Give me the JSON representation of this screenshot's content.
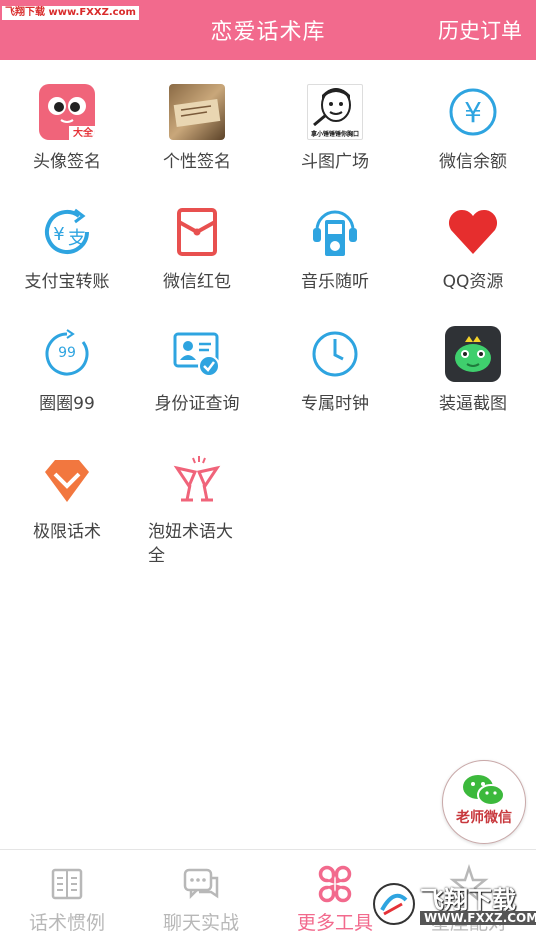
{
  "header": {
    "title": "恋爱话术库",
    "right_button": "历史订单",
    "watermark": "飞翔下载 www.FXXZ.com"
  },
  "tools": [
    {
      "label": "头像签名",
      "icon": "avatar-sticker-icon",
      "badge": "大全"
    },
    {
      "label": "个性签名",
      "icon": "signature-photo-icon"
    },
    {
      "label": "斗图广场",
      "icon": "meme-face-icon",
      "caption": "拿小锤锤锤你胸口"
    },
    {
      "label": "微信余额",
      "icon": "yuan-circle-icon"
    },
    {
      "label": "支付宝转账",
      "icon": "alipay-transfer-icon"
    },
    {
      "label": "微信红包",
      "icon": "red-envelope-icon"
    },
    {
      "label": "音乐随听",
      "icon": "music-player-icon"
    },
    {
      "label": "QQ资源",
      "icon": "heart-icon"
    },
    {
      "label": "圈圈99",
      "icon": "circle-99-icon",
      "badge": "99"
    },
    {
      "label": "身份证查询",
      "icon": "id-card-icon"
    },
    {
      "label": "专属时钟",
      "icon": "clock-icon"
    },
    {
      "label": "装逼截图",
      "icon": "frog-crown-icon"
    },
    {
      "label": "极限话术",
      "icon": "diamond-icon"
    },
    {
      "label": "泡妞术语大全",
      "icon": "cocktail-icon"
    }
  ],
  "fab": {
    "label": "老师微信",
    "icon": "wechat-icon"
  },
  "bottom_nav": [
    {
      "label": "话术惯例",
      "icon": "book-icon",
      "active": false
    },
    {
      "label": "聊天实战",
      "icon": "chat-icon",
      "active": false
    },
    {
      "label": "更多工具",
      "icon": "clover-grid-icon",
      "active": true
    },
    {
      "label": "星座配对",
      "icon": "star-icon",
      "active": false
    }
  ],
  "bottom_watermark": {
    "brand": "飞翔下载",
    "url": "WWW.FXXZ.COM"
  },
  "colors": {
    "accent": "#f26a8d",
    "blue": "#2ea4e0",
    "red": "#e53238"
  }
}
